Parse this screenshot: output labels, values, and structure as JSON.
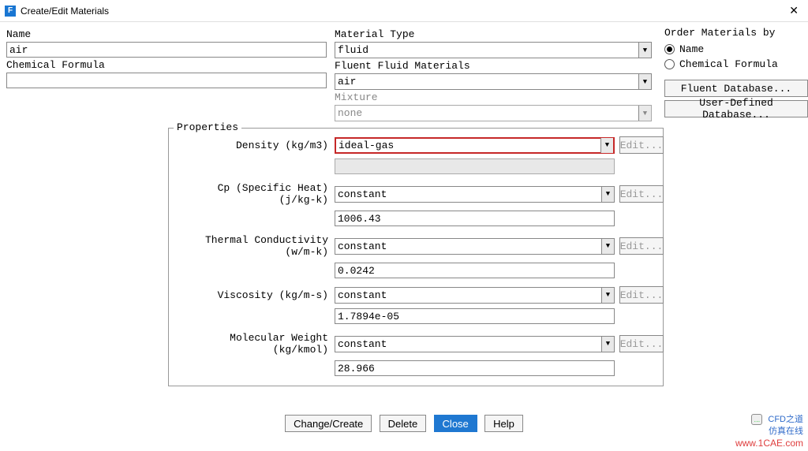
{
  "window": {
    "title": "Create/Edit Materials",
    "icon_letter": "F"
  },
  "left": {
    "name_label": "Name",
    "name_value": "air",
    "formula_label": "Chemical Formula",
    "formula_value": ""
  },
  "middle": {
    "type_label": "Material Type",
    "type_value": "fluid",
    "fluid_label": "Fluent Fluid Materials",
    "fluid_value": "air",
    "mixture_label": "Mixture",
    "mixture_value": "none"
  },
  "order": {
    "title": "Order Materials by",
    "opt_name": "Name",
    "opt_formula": "Chemical Formula",
    "selected": "name"
  },
  "rightButtons": {
    "fluent_db": "Fluent Database...",
    "user_db": "User-Defined Database..."
  },
  "props": {
    "legend": "Properties",
    "edit": "Edit...",
    "density": {
      "label": "Density (kg/m3)",
      "method": "ideal-gas",
      "value": ""
    },
    "cp": {
      "label": "Cp (Specific Heat) (j/kg-k)",
      "method": "constant",
      "value": "1006.43"
    },
    "tc": {
      "label": "Thermal Conductivity (w/m-k)",
      "method": "constant",
      "value": "0.0242"
    },
    "visc": {
      "label": "Viscosity (kg/m-s)",
      "method": "constant",
      "value": "1.7894e-05"
    },
    "mw": {
      "label": "Molecular Weight (kg/kmol)",
      "method": "constant",
      "value": "28.966"
    }
  },
  "bottom": {
    "change": "Change/Create",
    "delete": "Delete",
    "close": "Close",
    "help": "Help"
  },
  "watermark": {
    "line1_icon": "…",
    "line1_text": "CFD之道",
    "line2": "仿真在线",
    "site": "www.1CAE.com"
  }
}
